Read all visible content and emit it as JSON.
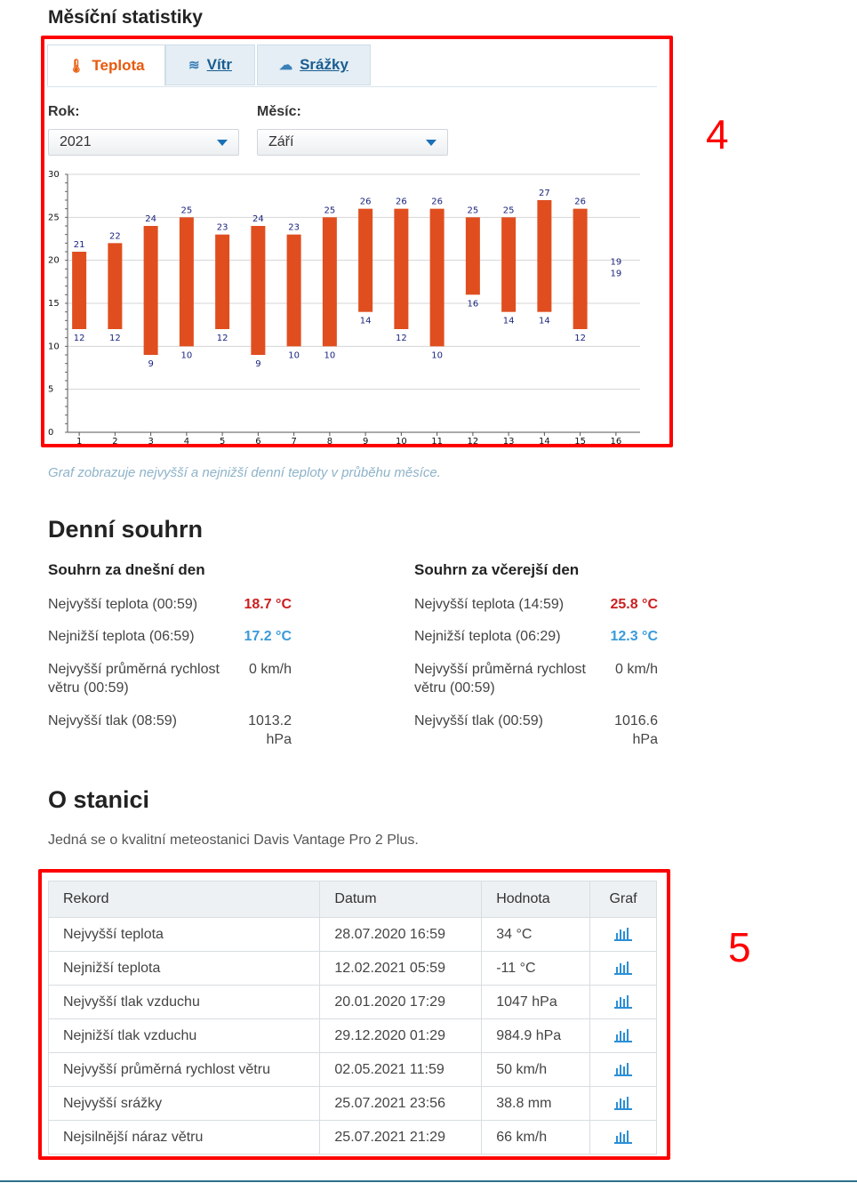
{
  "monthly": {
    "title": "Měsíční statistiky",
    "tabs": [
      {
        "label": "Teplota",
        "icon": "thermometer-icon",
        "active": true
      },
      {
        "label": "Vítr",
        "icon": "wind-icon",
        "active": false
      },
      {
        "label": "Srážky",
        "icon": "rain-cloud-icon",
        "active": false
      }
    ],
    "year_label": "Rok:",
    "year_value": "2021",
    "month_label": "Měsíc:",
    "month_value": "Září",
    "caption": "Graf zobrazuje nejvyšší a nejnižší denní teploty v průběhu měsíce."
  },
  "chart_data": {
    "type": "bar",
    "categories": [
      "1",
      "2",
      "3",
      "4",
      "5",
      "6",
      "7",
      "8",
      "9",
      "10",
      "11",
      "12",
      "13",
      "14",
      "15",
      "16"
    ],
    "series": [
      {
        "values": [
          21,
          22,
          24,
          25,
          23,
          24,
          23,
          25,
          26,
          26,
          26,
          25,
          25,
          27,
          26,
          19
        ]
      },
      {
        "values": [
          12,
          12,
          9,
          10,
          12,
          9,
          10,
          10,
          14,
          12,
          10,
          16,
          14,
          14,
          12,
          19
        ]
      }
    ],
    "ylim": [
      0,
      30
    ],
    "yticks": [
      0,
      5,
      10,
      15,
      20,
      25,
      30
    ],
    "grid": true,
    "color": "#e04e1f",
    "label_color": "#1a237e"
  },
  "daily": {
    "title": "Denní souhrn",
    "today": {
      "title": "Souhrn za dnešní den",
      "rows": [
        {
          "label": "Nejvyšší teplota (00:59)",
          "value": "18.7 °C",
          "kind": "hot"
        },
        {
          "label": "Nejnižší teplota (06:59)",
          "value": "17.2 °C",
          "kind": "cold"
        },
        {
          "label": "Nejvyšší průměrná rychlost větru (00:59)",
          "value": "0 km/h",
          "kind": "plain"
        },
        {
          "label": "Nejvyšší tlak (08:59)",
          "value": "1013.2 hPa",
          "kind": "plain"
        }
      ]
    },
    "yesterday": {
      "title": "Souhrn za včerejší den",
      "rows": [
        {
          "label": "Nejvyšší teplota (14:59)",
          "value": "25.8 °C",
          "kind": "hot"
        },
        {
          "label": "Nejnižší teplota (06:29)",
          "value": "12.3 °C",
          "kind": "cold"
        },
        {
          "label": "Nejvyšší průměrná rychlost větru (00:59)",
          "value": "0 km/h",
          "kind": "plain"
        },
        {
          "label": "Nejvyšší tlak (00:59)",
          "value": "1016.6 hPa",
          "kind": "plain"
        }
      ]
    }
  },
  "station": {
    "title": "O stanici",
    "description": "Jedná se o kvalitní meteostanici Davis Vantage Pro 2 Plus.",
    "table": {
      "headers": [
        "Rekord",
        "Datum",
        "Hodnota",
        "Graf"
      ],
      "rows": [
        [
          "Nejvyšší teplota",
          "28.07.2020 16:59",
          "34 °C"
        ],
        [
          "Nejnižší teplota",
          "12.02.2021 05:59",
          "-11 °C"
        ],
        [
          "Nejvyšší tlak vzduchu",
          "20.01.2020 17:29",
          "1047 hPa"
        ],
        [
          "Nejnižší tlak vzduchu",
          "29.12.2020 01:29",
          "984.9 hPa"
        ],
        [
          "Nejvyšší průměrná rychlost větru",
          "02.05.2021 11:59",
          "50 km/h"
        ],
        [
          "Nejvyšší srážky",
          "25.07.2021 23:56",
          "38.8 mm"
        ],
        [
          "Nejsilnější náraz větru",
          "25.07.2021 21:29",
          "66 km/h"
        ]
      ]
    }
  },
  "annotations": {
    "box4": "4",
    "box5": "5",
    "color": "#ff0000"
  }
}
